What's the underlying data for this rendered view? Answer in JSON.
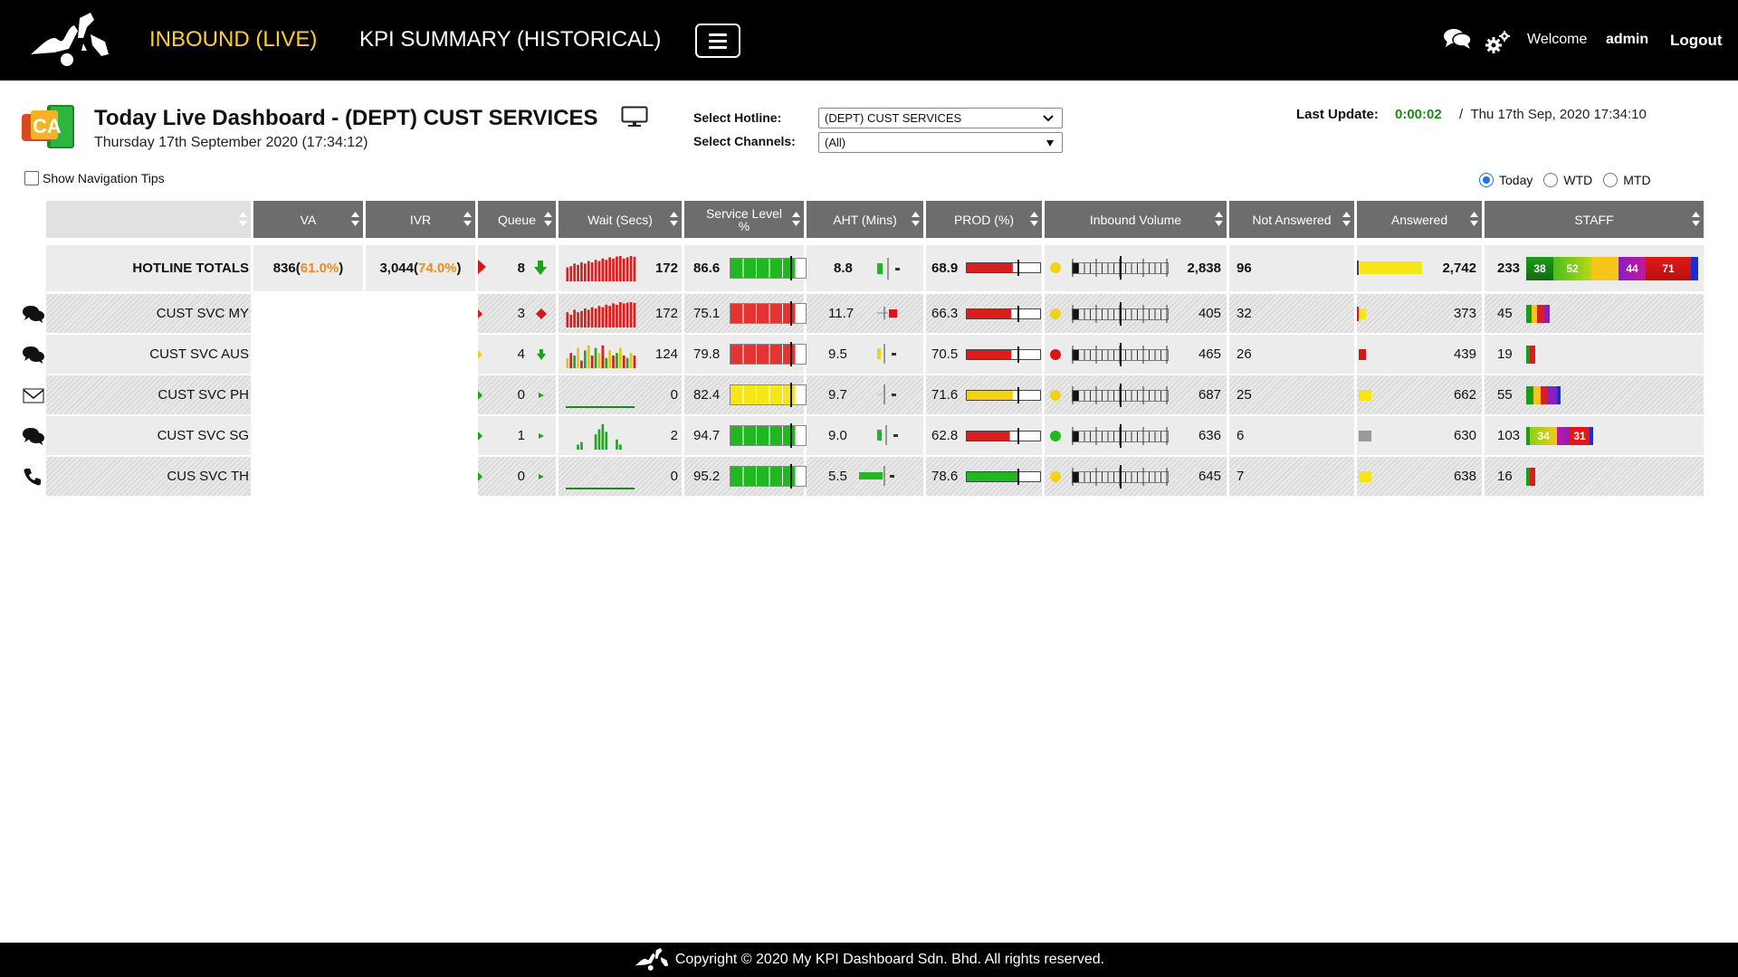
{
  "header": {
    "nav_live": "INBOUND (LIVE)",
    "nav_kpi": "KPI SUMMARY (HISTORICAL)",
    "welcome": "Welcome",
    "user": "admin",
    "logout": "Logout"
  },
  "page": {
    "title": "Today Live Dashboard - (DEPT) CUST SERVICES",
    "date": "Thursday 17th September 2020 (17:34:12)",
    "select_hotline_label": "Select Hotline:",
    "select_hotline_value": "(DEPT) CUST SERVICES",
    "select_channels_label": "Select Channels:",
    "select_channels_value": "(All)",
    "last_update_label": "Last Update:",
    "last_update_value": "0:00:02",
    "last_update_sep": "/",
    "last_update_ts": "Thu 17th Sep, 2020 17:34:10",
    "show_tips": "Show Navigation Tips",
    "periods": [
      "Today",
      "WTD",
      "MTD"
    ],
    "period_selected": "Today"
  },
  "table": {
    "columns": [
      "",
      "VA",
      "IVR",
      "Queue",
      "Wait (Secs)",
      "Service Level %",
      "AHT (Mins)",
      "PROD (%)",
      "Inbound Volume",
      "Not Answered",
      "Answered",
      "STAFF"
    ],
    "totals": {
      "name": "HOTLINE TOTALS",
      "va": "836",
      "va_pct": "61.0%",
      "ivr": "3,044",
      "ivr_pct": "74.0%",
      "queue": "8",
      "wait": "172",
      "sl": "86.6",
      "aht": "8.8",
      "prod": "68.9",
      "inbound": "2,838",
      "not_answered": "96",
      "answered": "2,742",
      "staff": "233",
      "staff_segments": [
        "38",
        "52",
        "44",
        "71"
      ]
    },
    "rows": [
      {
        "icon": "chat",
        "name": "CUST SVC MY",
        "queue": "3",
        "wait": "172",
        "sl": "75.1",
        "aht": "11.7",
        "prod": "66.3",
        "inbound": "405",
        "not_answered": "32",
        "answered": "373",
        "staff": "45"
      },
      {
        "icon": "chat",
        "name": "CUST SVC AUS",
        "queue": "4",
        "wait": "124",
        "sl": "79.8",
        "aht": "9.5",
        "prod": "70.5",
        "inbound": "465",
        "not_answered": "26",
        "answered": "439",
        "staff": "19"
      },
      {
        "icon": "email",
        "name": "CUST SVC PH",
        "queue": "0",
        "wait": "0",
        "sl": "82.4",
        "aht": "9.7",
        "prod": "71.6",
        "inbound": "687",
        "not_answered": "25",
        "answered": "662",
        "staff": "55"
      },
      {
        "icon": "chat",
        "name": "CUST SVC SG",
        "queue": "1",
        "wait": "2",
        "sl": "94.7",
        "aht": "9.0",
        "prod": "62.8",
        "inbound": "636",
        "not_answered": "6",
        "answered": "630",
        "staff": "103",
        "staff_segments": [
          "34",
          "31"
        ]
      },
      {
        "icon": "phone",
        "name": "CUS SVC TH",
        "queue": "0",
        "wait": "0",
        "sl": "95.2",
        "aht": "5.5",
        "prod": "78.6",
        "inbound": "645",
        "not_answered": "7",
        "answered": "638",
        "staff": "16"
      }
    ]
  },
  "footer": {
    "copyright": "Copyright © 2020 My KPI Dashboard Sdn. Bhd. All rights reserved."
  }
}
